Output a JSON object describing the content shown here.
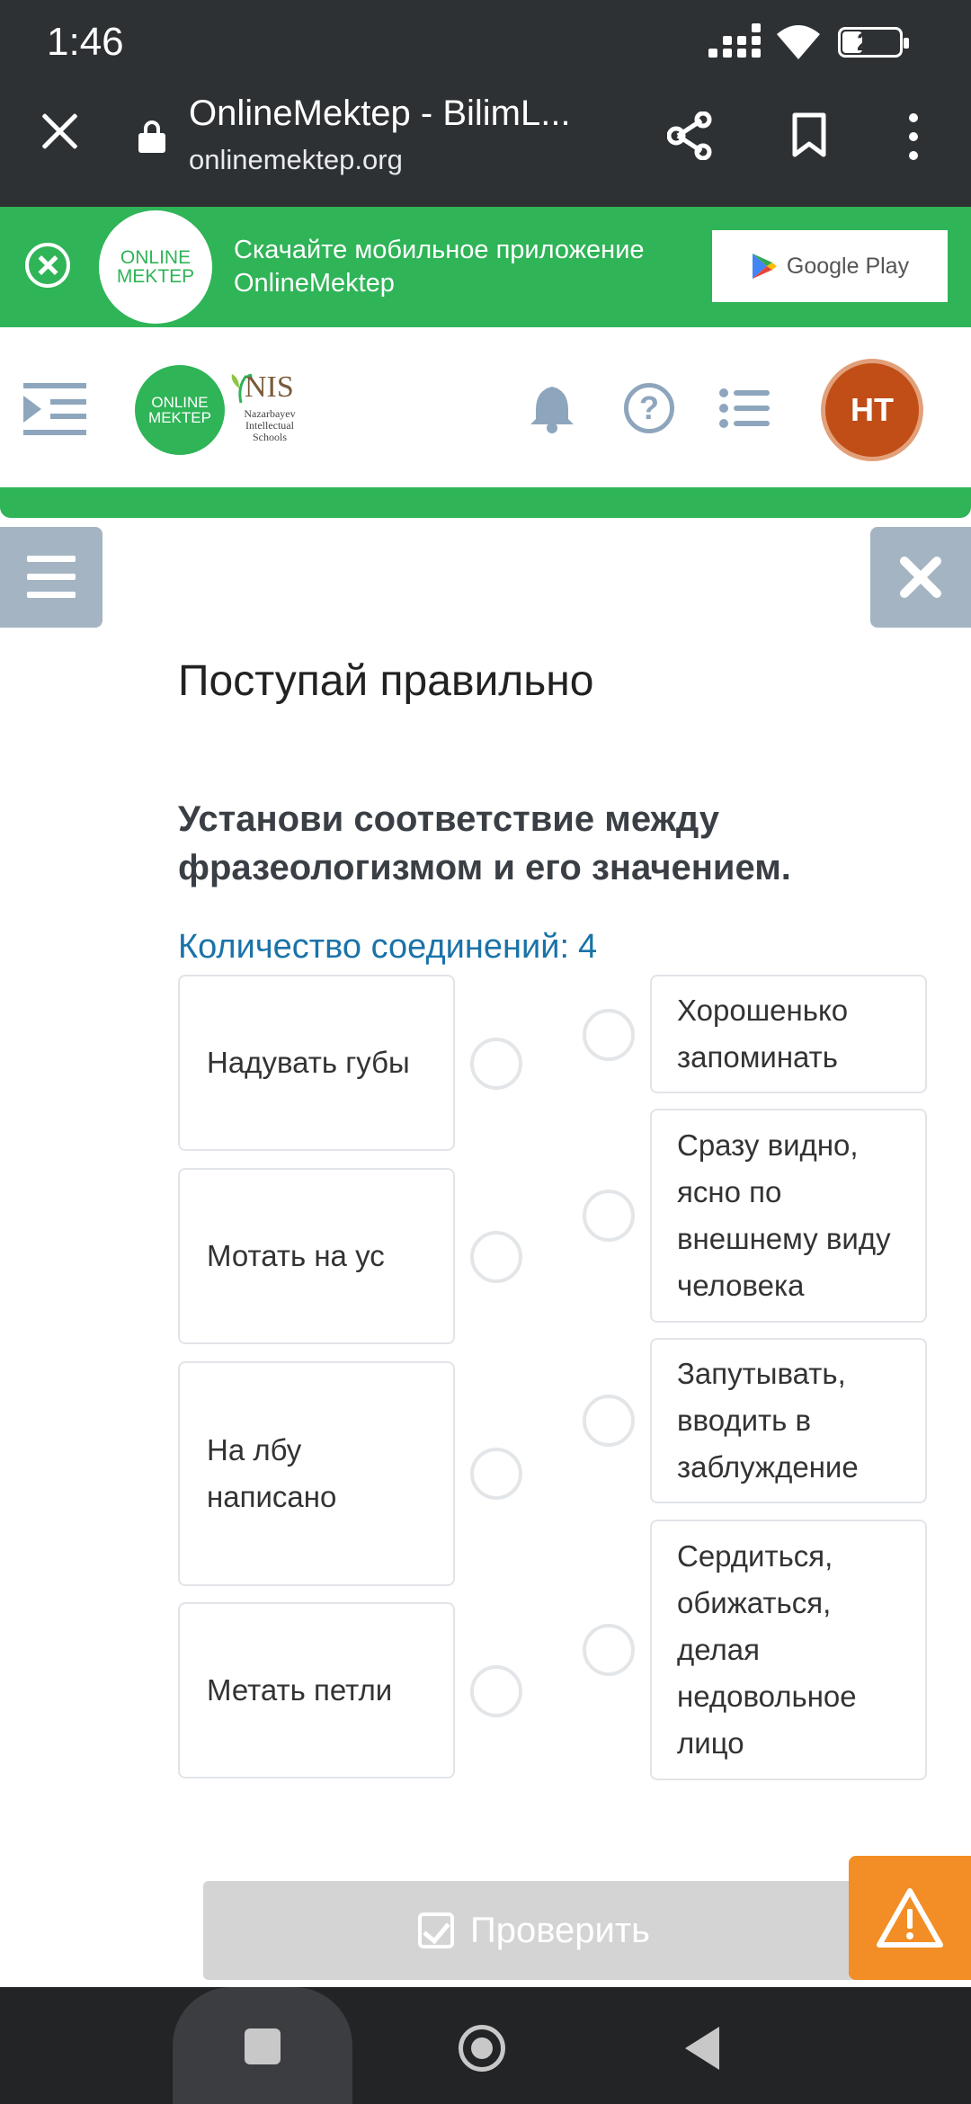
{
  "status_bar": {
    "time": "1:46",
    "battery": "27"
  },
  "browser": {
    "title": "OnlineMektep - BilimL...",
    "url": "onlinemektep.org"
  },
  "banner": {
    "logo_line1": "ONLINE",
    "logo_line2": "MEKTEP",
    "text_line1": "Скачайте мобильное приложение",
    "text_line2": "OnlineMektep",
    "store_label": "Google Play"
  },
  "header": {
    "logo_line1": "ONLINE",
    "logo_line2": "MEKTEP",
    "nis_logo": "NIS",
    "nis_sub1": "Nazarbayev",
    "nis_sub2": "Intellectual",
    "nis_sub3": "Schools",
    "avatar_initials": "НТ"
  },
  "content": {
    "title": "Поступай правильно",
    "question": "Установи соответствие между фразеологизмом и его значением.",
    "connections_label": "Количество соединений:",
    "connections_count": "4",
    "left_items": [
      {
        "label": "Надувать губы"
      },
      {
        "label": "Мотать на ус"
      },
      {
        "label": "На лбу написано"
      },
      {
        "label": "Метать петли"
      }
    ],
    "right_items": [
      {
        "label": "Хорошенько запоминать"
      },
      {
        "label": "Сразу видно, ясно по внешнему виду человека"
      },
      {
        "label": "Запутывать, вводить в заблуждение"
      },
      {
        "label": "Сердиться, обижаться, делая недовольное лицо"
      }
    ],
    "check_button": "Проверить"
  },
  "colors": {
    "brand_green": "#2fb457",
    "link_blue": "#1a73a8",
    "warning_orange": "#f28e25",
    "avatar": "#c14d17"
  }
}
